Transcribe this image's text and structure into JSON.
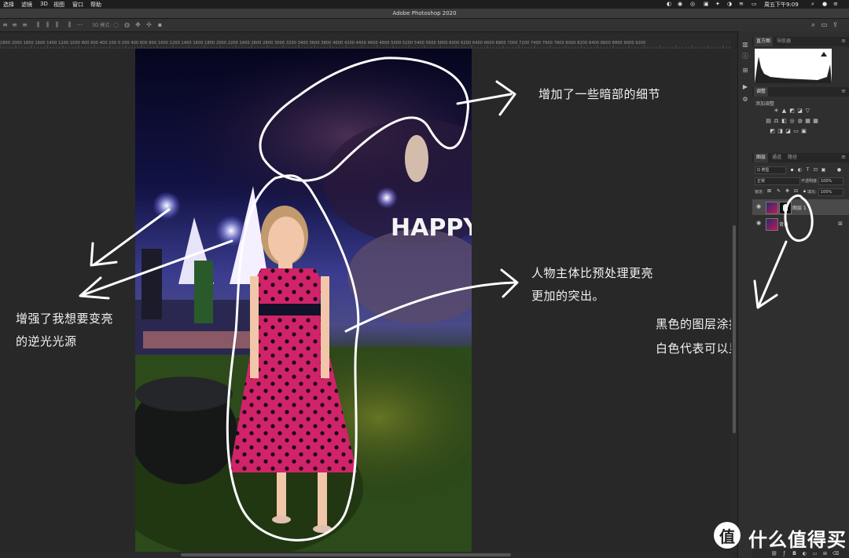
{
  "menubar": {
    "items": [
      "选择",
      "滤镜",
      "3D",
      "视图",
      "窗口",
      "帮助"
    ],
    "clock": "周五下午9:09"
  },
  "window": {
    "title": "Adobe Photoshop 2020"
  },
  "optionsbar": {
    "mode_3d": "3D 模式:"
  },
  "ruler": {
    "labels": "1800 2000 1800 1600 1400 1200 1000 800 600 400 200 0 200 400 600 800 1000 1200 1400 1600 1800 2000 2200 2400 2600 2800 3000 3200 3400 3600 3800 4000 4200 4400 4600 4800 5000 5200 5400 5600 5800 6000 6200 6400 6600 6800 7000 7200 7400 7600 7800 8000 8200 8400 8600 8800 9000 9200"
  },
  "annotations": {
    "dark_details": "增加了一些暗部的细节",
    "backlight": [
      "增强了我想要变亮",
      "的逆光光源"
    ],
    "subject": [
      "人物主体比预处理更亮",
      "更加的突出。"
    ],
    "layer_mask": [
      "黑色的图层涂抹后的结果",
      "白色代表可以显示效果的部分"
    ]
  },
  "photo": {
    "sign_text": "HAPPY"
  },
  "panels": {
    "histogram_tabs": [
      "直方图",
      "导航器"
    ],
    "adjust_tab": "调整",
    "adjust_add": "添加调整",
    "layers_tabs": [
      "图层",
      "通道",
      "路径"
    ],
    "filter_kind": "Q 类型",
    "blend_mode": "正常",
    "opacity_label": "不透明度:",
    "opacity_value": "100%",
    "lock_label": "锁定:",
    "fill_label": "填充:",
    "fill_value": "100%",
    "layers": [
      {
        "name": "图层 1",
        "selected": true
      },
      {
        "name": "背景",
        "selected": false
      }
    ]
  },
  "watermark": {
    "text": "什么值得买",
    "logo_char": "值"
  },
  "colors": {
    "panel_bg": "#2f2f2f",
    "canvas_bg": "#282828",
    "dress": "#c2185b",
    "stroke": "#ffffff"
  }
}
